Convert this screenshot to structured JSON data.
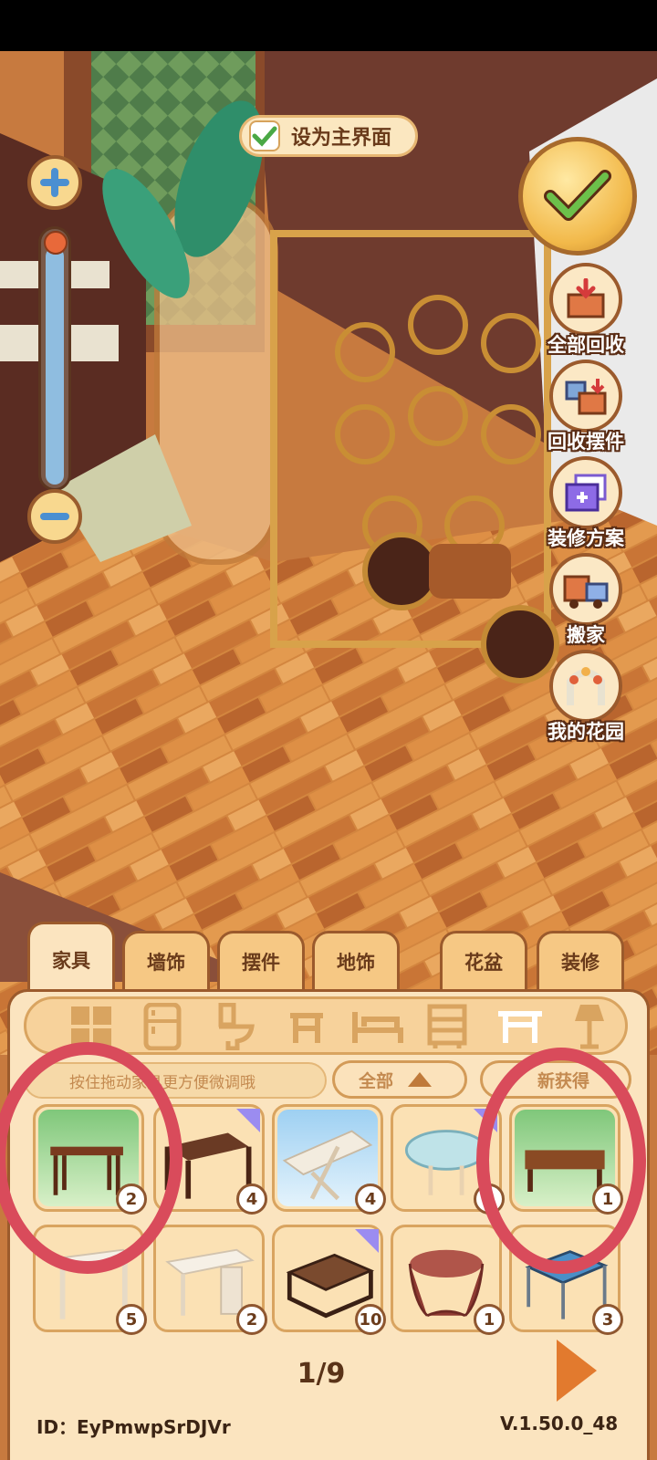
{
  "top_bar": {
    "set_main_label": "设为主界面"
  },
  "side_menu": [
    {
      "label": "全部回收",
      "icon": "recycle-all-icon"
    },
    {
      "label": "回收摆件",
      "icon": "recycle-decor-icon"
    },
    {
      "label": "装修方案",
      "icon": "renovation-plan-icon"
    },
    {
      "label": "搬家",
      "icon": "moving-truck-icon"
    },
    {
      "label": "我的花园",
      "icon": "garden-arch-icon"
    }
  ],
  "tabs": [
    {
      "label": "家具",
      "active": true
    },
    {
      "label": "墙饰",
      "active": false
    },
    {
      "label": "摆件",
      "active": false
    },
    {
      "label": "地饰",
      "active": false
    },
    {
      "label": "花盆",
      "active": false
    },
    {
      "label": "装修",
      "active": false
    }
  ],
  "categories": [
    "all-grid-icon",
    "fridge-icon",
    "toilet-icon",
    "stool-icon",
    "bed-icon",
    "cabinet-icon",
    "table-icon",
    "lamp-icon"
  ],
  "selected_category": "table-icon",
  "hint_text": "按住拖动家具更方便微调哦",
  "filters": {
    "scope": "全部",
    "sort": "新获得"
  },
  "items": [
    {
      "name": "altar-table",
      "count": "2",
      "highlighted": true,
      "new": false,
      "bg": "green"
    },
    {
      "name": "dark-desk",
      "count": "4",
      "highlighted": false,
      "new": true,
      "bg": "beige"
    },
    {
      "name": "white-trestle-table",
      "count": "4",
      "highlighted": false,
      "new": false,
      "bg": "blue"
    },
    {
      "name": "glass-oval-table",
      "count": "1",
      "highlighted": false,
      "new": true,
      "bg": "beige"
    },
    {
      "name": "low-wood-table",
      "count": "1",
      "highlighted": true,
      "new": false,
      "bg": "green"
    },
    {
      "name": "white-console",
      "count": "5",
      "highlighted": false,
      "new": false,
      "bg": "beige"
    },
    {
      "name": "white-drawer-desk",
      "count": "2",
      "highlighted": false,
      "new": false,
      "bg": "beige"
    },
    {
      "name": "dark-coffee-table",
      "count": "10",
      "highlighted": false,
      "new": true,
      "bg": "beige"
    },
    {
      "name": "round-cloth-table",
      "count": "1",
      "highlighted": false,
      "new": false,
      "bg": "beige"
    },
    {
      "name": "blue-side-table",
      "count": "3",
      "highlighted": false,
      "new": false,
      "bg": "beige"
    }
  ],
  "pagination": {
    "current": "1/9"
  },
  "footer": {
    "id_text": "ID：EyPmwpSrDJVr",
    "version": "V.1.50.0_48"
  },
  "colors": {
    "accent": "#9b5a2c",
    "highlight_ring": "#d94b5b",
    "panel": "#fbe4bf",
    "floor": "#c77a3f"
  }
}
